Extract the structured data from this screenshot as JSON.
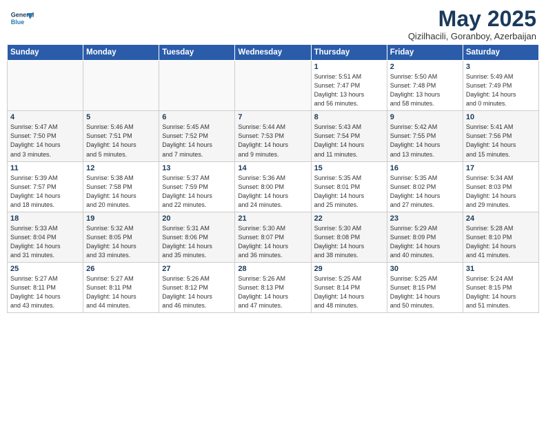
{
  "header": {
    "logo_line1": "General",
    "logo_line2": "Blue",
    "month": "May 2025",
    "location": "Qizilhacili, Goranboy, Azerbaijan"
  },
  "weekdays": [
    "Sunday",
    "Monday",
    "Tuesday",
    "Wednesday",
    "Thursday",
    "Friday",
    "Saturday"
  ],
  "weeks": [
    [
      {
        "day": "",
        "info": ""
      },
      {
        "day": "",
        "info": ""
      },
      {
        "day": "",
        "info": ""
      },
      {
        "day": "",
        "info": ""
      },
      {
        "day": "1",
        "info": "Sunrise: 5:51 AM\nSunset: 7:47 PM\nDaylight: 13 hours\nand 56 minutes."
      },
      {
        "day": "2",
        "info": "Sunrise: 5:50 AM\nSunset: 7:48 PM\nDaylight: 13 hours\nand 58 minutes."
      },
      {
        "day": "3",
        "info": "Sunrise: 5:49 AM\nSunset: 7:49 PM\nDaylight: 14 hours\nand 0 minutes."
      }
    ],
    [
      {
        "day": "4",
        "info": "Sunrise: 5:47 AM\nSunset: 7:50 PM\nDaylight: 14 hours\nand 3 minutes."
      },
      {
        "day": "5",
        "info": "Sunrise: 5:46 AM\nSunset: 7:51 PM\nDaylight: 14 hours\nand 5 minutes."
      },
      {
        "day": "6",
        "info": "Sunrise: 5:45 AM\nSunset: 7:52 PM\nDaylight: 14 hours\nand 7 minutes."
      },
      {
        "day": "7",
        "info": "Sunrise: 5:44 AM\nSunset: 7:53 PM\nDaylight: 14 hours\nand 9 minutes."
      },
      {
        "day": "8",
        "info": "Sunrise: 5:43 AM\nSunset: 7:54 PM\nDaylight: 14 hours\nand 11 minutes."
      },
      {
        "day": "9",
        "info": "Sunrise: 5:42 AM\nSunset: 7:55 PM\nDaylight: 14 hours\nand 13 minutes."
      },
      {
        "day": "10",
        "info": "Sunrise: 5:41 AM\nSunset: 7:56 PM\nDaylight: 14 hours\nand 15 minutes."
      }
    ],
    [
      {
        "day": "11",
        "info": "Sunrise: 5:39 AM\nSunset: 7:57 PM\nDaylight: 14 hours\nand 18 minutes."
      },
      {
        "day": "12",
        "info": "Sunrise: 5:38 AM\nSunset: 7:58 PM\nDaylight: 14 hours\nand 20 minutes."
      },
      {
        "day": "13",
        "info": "Sunrise: 5:37 AM\nSunset: 7:59 PM\nDaylight: 14 hours\nand 22 minutes."
      },
      {
        "day": "14",
        "info": "Sunrise: 5:36 AM\nSunset: 8:00 PM\nDaylight: 14 hours\nand 24 minutes."
      },
      {
        "day": "15",
        "info": "Sunrise: 5:35 AM\nSunset: 8:01 PM\nDaylight: 14 hours\nand 25 minutes."
      },
      {
        "day": "16",
        "info": "Sunrise: 5:35 AM\nSunset: 8:02 PM\nDaylight: 14 hours\nand 27 minutes."
      },
      {
        "day": "17",
        "info": "Sunrise: 5:34 AM\nSunset: 8:03 PM\nDaylight: 14 hours\nand 29 minutes."
      }
    ],
    [
      {
        "day": "18",
        "info": "Sunrise: 5:33 AM\nSunset: 8:04 PM\nDaylight: 14 hours\nand 31 minutes."
      },
      {
        "day": "19",
        "info": "Sunrise: 5:32 AM\nSunset: 8:05 PM\nDaylight: 14 hours\nand 33 minutes."
      },
      {
        "day": "20",
        "info": "Sunrise: 5:31 AM\nSunset: 8:06 PM\nDaylight: 14 hours\nand 35 minutes."
      },
      {
        "day": "21",
        "info": "Sunrise: 5:30 AM\nSunset: 8:07 PM\nDaylight: 14 hours\nand 36 minutes."
      },
      {
        "day": "22",
        "info": "Sunrise: 5:30 AM\nSunset: 8:08 PM\nDaylight: 14 hours\nand 38 minutes."
      },
      {
        "day": "23",
        "info": "Sunrise: 5:29 AM\nSunset: 8:09 PM\nDaylight: 14 hours\nand 40 minutes."
      },
      {
        "day": "24",
        "info": "Sunrise: 5:28 AM\nSunset: 8:10 PM\nDaylight: 14 hours\nand 41 minutes."
      }
    ],
    [
      {
        "day": "25",
        "info": "Sunrise: 5:27 AM\nSunset: 8:11 PM\nDaylight: 14 hours\nand 43 minutes."
      },
      {
        "day": "26",
        "info": "Sunrise: 5:27 AM\nSunset: 8:11 PM\nDaylight: 14 hours\nand 44 minutes."
      },
      {
        "day": "27",
        "info": "Sunrise: 5:26 AM\nSunset: 8:12 PM\nDaylight: 14 hours\nand 46 minutes."
      },
      {
        "day": "28",
        "info": "Sunrise: 5:26 AM\nSunset: 8:13 PM\nDaylight: 14 hours\nand 47 minutes."
      },
      {
        "day": "29",
        "info": "Sunrise: 5:25 AM\nSunset: 8:14 PM\nDaylight: 14 hours\nand 48 minutes."
      },
      {
        "day": "30",
        "info": "Sunrise: 5:25 AM\nSunset: 8:15 PM\nDaylight: 14 hours\nand 50 minutes."
      },
      {
        "day": "31",
        "info": "Sunrise: 5:24 AM\nSunset: 8:15 PM\nDaylight: 14 hours\nand 51 minutes."
      }
    ]
  ]
}
